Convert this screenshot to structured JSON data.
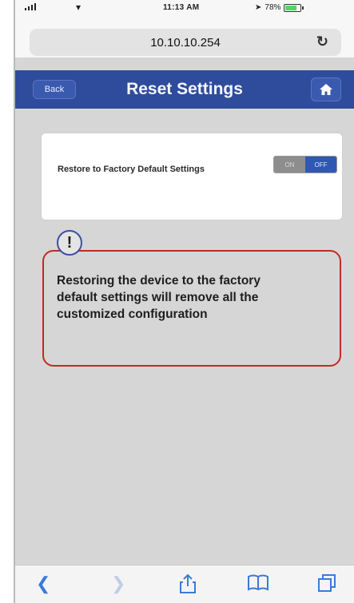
{
  "status_bar": {
    "time": "11:13 AM",
    "battery": "78%"
  },
  "browser": {
    "url": "10.10.10.254",
    "reload_icon": "reload-icon"
  },
  "header": {
    "back_label": "Back",
    "title": "Reset Settings",
    "home_icon": "home-icon"
  },
  "card": {
    "label": "Restore to Factory Default Settings",
    "toggle": {
      "on_label": "ON",
      "off_label": "OFF",
      "selected": "OFF"
    }
  },
  "warning": {
    "icon": "exclamation-icon",
    "icon_glyph": "!",
    "text": "Restoring the device to the factory default settings will remove all the customized configuration",
    "border_color": "#c12a25"
  },
  "toolbar": {
    "items": [
      "back-icon",
      "forward-icon",
      "share-icon",
      "bookmarks-icon",
      "tabs-icon"
    ]
  },
  "colors": {
    "header": "#2f4c9c",
    "background": "#d6d6d6",
    "accent": "#2f58b5"
  }
}
